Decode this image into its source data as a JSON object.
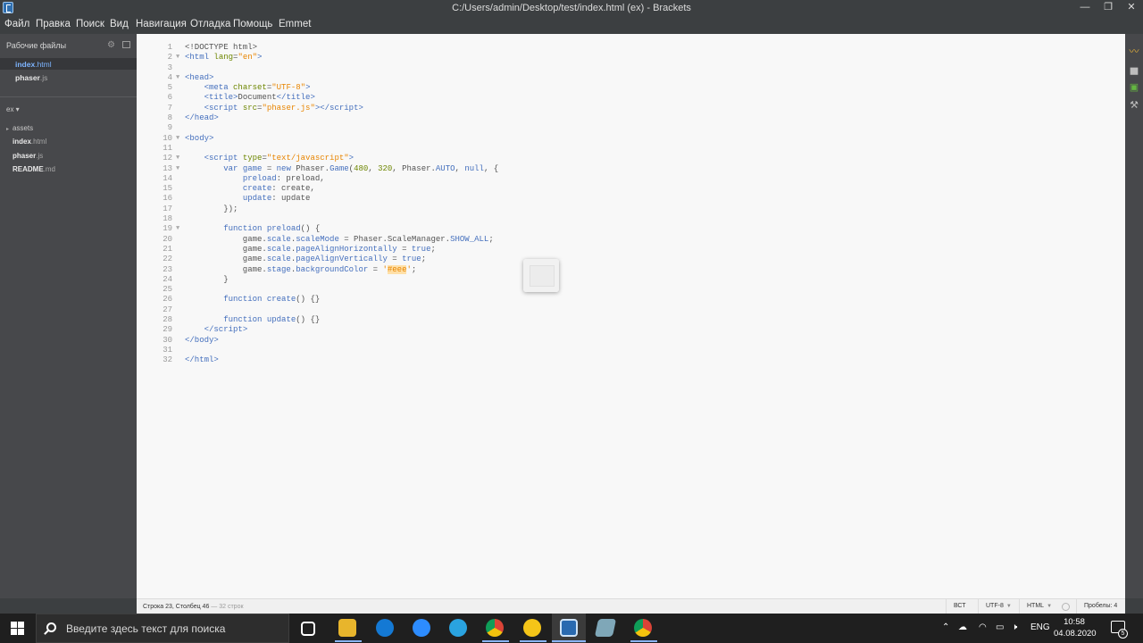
{
  "window": {
    "title": "C:/Users/admin/Desktop/test/index.html (ex) - Brackets",
    "minimize": "—",
    "restore": "❐",
    "close": "✕"
  },
  "menu": [
    "Файл",
    "Правка",
    "Поиск",
    "Вид",
    "Навигация",
    "Отладка",
    "Помощь",
    "Emmet"
  ],
  "sidebar": {
    "working_files_title": "Рабочие файлы",
    "working_files": [
      {
        "name": "index",
        "ext": ".html",
        "active": true
      },
      {
        "name": "phaser",
        "ext": ".js",
        "active": false
      }
    ],
    "project_name": "ex ▾",
    "tree": [
      {
        "name": "assets",
        "ext": "",
        "folder": true
      },
      {
        "name": "index",
        "ext": ".html",
        "folder": false
      },
      {
        "name": "phaser",
        "ext": ".js",
        "folder": false
      },
      {
        "name": "README",
        "ext": ".md",
        "folder": false
      }
    ]
  },
  "code_lines": [
    {
      "n": "1",
      "fold": false,
      "html": "<span class='t-def'>&lt;!DOCTYPE html&gt;</span>"
    },
    {
      "n": "2",
      "fold": true,
      "html": "<span class='t-tag'>&lt;html</span> <span class='t-attr'>lang</span>=<span class='t-str'>\"en\"</span><span class='t-tag'>&gt;</span>"
    },
    {
      "n": "3",
      "fold": false,
      "html": ""
    },
    {
      "n": "4",
      "fold": true,
      "html": "<span class='t-tag'>&lt;head&gt;</span>"
    },
    {
      "n": "5",
      "fold": false,
      "html": "    <span class='t-tag'>&lt;meta</span> <span class='t-attr'>charset</span>=<span class='t-str'>\"UTF-8\"</span><span class='t-tag'>&gt;</span>"
    },
    {
      "n": "6",
      "fold": false,
      "html": "    <span class='t-tag'>&lt;title&gt;</span>Document<span class='t-tag'>&lt;/title&gt;</span>"
    },
    {
      "n": "7",
      "fold": false,
      "html": "    <span class='t-tag'>&lt;script</span> <span class='t-attr'>src</span>=<span class='t-str'>\"phaser.js\"</span><span class='t-tag'>&gt;&lt;/script&gt;</span>"
    },
    {
      "n": "8",
      "fold": false,
      "html": "<span class='t-tag'>&lt;/head&gt;</span>"
    },
    {
      "n": "9",
      "fold": false,
      "html": ""
    },
    {
      "n": "10",
      "fold": true,
      "html": "<span class='t-tag'>&lt;body&gt;</span>"
    },
    {
      "n": "11",
      "fold": false,
      "html": ""
    },
    {
      "n": "12",
      "fold": true,
      "html": "    <span class='t-tag'>&lt;script</span> <span class='t-attr'>type</span>=<span class='t-str'>\"text/javascript\"</span><span class='t-tag'>&gt;</span>"
    },
    {
      "n": "13",
      "fold": true,
      "html": "        <span class='t-kw'>var</span> <span class='t-kw'>game</span> = <span class='t-kw'>new</span> Phaser.<span class='t-kw'>Game</span>(<span class='t-num'>480</span>, <span class='t-num'>320</span>, Phaser.<span class='t-kw'>AUTO</span>, <span class='t-kw'>null</span>, {"
    },
    {
      "n": "14",
      "fold": false,
      "html": "            <span class='t-kw'>preload</span>: preload,"
    },
    {
      "n": "15",
      "fold": false,
      "html": "            <span class='t-kw'>create</span>: create,"
    },
    {
      "n": "16",
      "fold": false,
      "html": "            <span class='t-kw'>update</span>: update"
    },
    {
      "n": "17",
      "fold": false,
      "html": "        });"
    },
    {
      "n": "18",
      "fold": false,
      "html": ""
    },
    {
      "n": "19",
      "fold": true,
      "html": "        <span class='t-kw'>function</span> <span class='t-kw'>preload</span>() {"
    },
    {
      "n": "20",
      "fold": false,
      "html": "            game.<span class='t-kw'>scale</span>.<span class='t-kw'>scaleMode</span> = Phaser.ScaleManager.<span class='t-kw'>SHOW_ALL</span>;"
    },
    {
      "n": "21",
      "fold": false,
      "html": "            game.<span class='t-kw'>scale</span>.<span class='t-kw'>pageAlignHorizontally</span> = <span class='t-kw'>true</span>;"
    },
    {
      "n": "22",
      "fold": false,
      "html": "            game.<span class='t-kw'>scale</span>.<span class='t-kw'>pageAlignVertically</span> = <span class='t-kw'>true</span>;"
    },
    {
      "n": "23",
      "fold": false,
      "html": "            game.<span class='t-kw'>stage</span>.<span class='t-kw'>backgroundColor</span> = <span class='t-str'>'<span class='t-hl'>#eee</span>'</span>;"
    },
    {
      "n": "24",
      "fold": false,
      "html": "        }"
    },
    {
      "n": "25",
      "fold": false,
      "html": ""
    },
    {
      "n": "26",
      "fold": false,
      "html": "        <span class='t-kw'>function</span> <span class='t-kw'>create</span>() {}"
    },
    {
      "n": "27",
      "fold": false,
      "html": ""
    },
    {
      "n": "28",
      "fold": false,
      "html": "        <span class='t-kw'>function</span> <span class='t-kw'>update</span>() {}"
    },
    {
      "n": "29",
      "fold": false,
      "html": "    <span class='t-tag'>&lt;/script&gt;</span>"
    },
    {
      "n": "30",
      "fold": false,
      "html": "<span class='t-tag'>&lt;/body&gt;</span>"
    },
    {
      "n": "31",
      "fold": false,
      "html": ""
    },
    {
      "n": "32",
      "fold": false,
      "html": "<span class='t-tag'>&lt;/html&gt;</span>"
    }
  ],
  "statusbar": {
    "position": "Строка 23, Столбец 46",
    "line_count": " — 32 строк",
    "insert_mode": "ВСТ",
    "encoding": "UTF-8",
    "language": "HTML",
    "indent": "Пробелы: 4"
  },
  "taskbar": {
    "search_placeholder": "Введите здесь текст для поиска",
    "lang": "ENG",
    "time": "10:58",
    "date": "04.08.2020",
    "notifications": "5"
  },
  "colors": {
    "chrome_bg": "#3c3f41",
    "sidebar_bg": "#47484b",
    "editor_bg": "#f8f8f8",
    "accent": "#7db4ff"
  }
}
